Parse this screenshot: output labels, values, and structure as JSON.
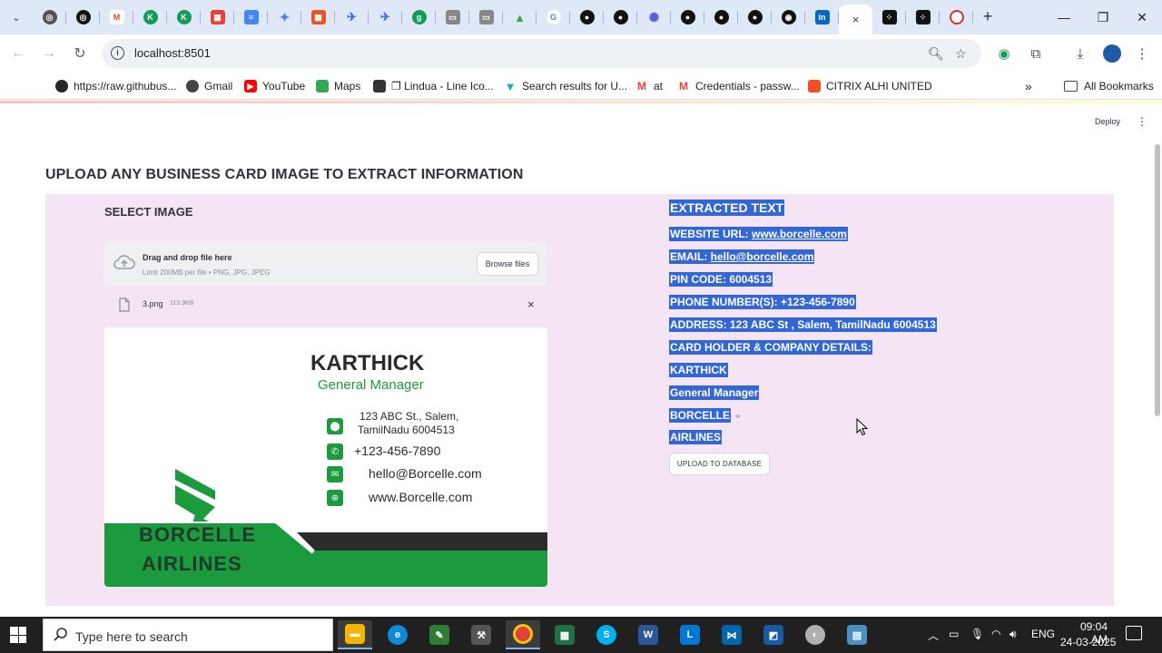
{
  "browser": {
    "tabs_count_note": "",
    "active_tab_close": "×",
    "new_tab": "+",
    "url": "localhost:8501"
  },
  "bookmarks": [
    {
      "label": "https://raw.githubus...",
      "icon": "github-icon",
      "color": "#24292f"
    },
    {
      "label": "Gmail",
      "icon": "globe-icon",
      "color": "#444444"
    },
    {
      "label": "YouTube",
      "icon": "youtube-icon",
      "color": "#ff0000"
    },
    {
      "label": "Maps",
      "icon": "maps-icon",
      "color": "#34a853"
    },
    {
      "label": "❐ Lindua - Line Ico...",
      "icon": "lindua-icon",
      "color": "#333333"
    },
    {
      "label": "Search results for U...",
      "icon": "vector-icon",
      "color": "#20b2aa"
    },
    {
      "label": "at",
      "icon": "gmail-icon",
      "color": "#ea4335"
    },
    {
      "label": "Credentials - passw...",
      "icon": "gmail-icon",
      "color": "#ea4335"
    },
    {
      "label": "CITRIX ALHI UNITED",
      "icon": "windows-icon",
      "color": "#f25022"
    }
  ],
  "bookmarks_more": "»",
  "all_bookmarks": "All Bookmarks",
  "app": {
    "deploy": "Deploy",
    "title": "UPLOAD ANY BUSINESS CARD IMAGE TO EXTRACT INFORMATION",
    "select_label": "SELECT IMAGE",
    "dropzone": {
      "title": "Drag and drop file here",
      "limit": "Limit 200MB per file • PNG, JPG, JPEG",
      "browse": "Browse files"
    },
    "file": {
      "name": "3.png",
      "size": "113.9KB",
      "remove": "×"
    },
    "card": {
      "name": "KARTHICK",
      "role": "General Manager",
      "address_line1": "123 ABC St., Salem,",
      "address_line2": "TamilNadu 6004513",
      "phone": "+123-456-7890",
      "email": "hello@Borcelle.com",
      "website": "www.Borcelle.com",
      "brand_line1": "BORCELLE",
      "brand_line2": "AIRLINES"
    },
    "extracted": {
      "title": "EXTRACTED TEXT",
      "website_label": "WEBSITE URL: ",
      "website_value": "www.borcelle.com",
      "email_label": "EMAIL: ",
      "email_value": "hello@borcelle.com",
      "pin": "PIN CODE: 6004513",
      "phone": "PHONE NUMBER(S): +123-456-7890",
      "address": "ADDRESS: 123 ABC St , Salem, TamilNadu 6004513",
      "details_header": "CARD HOLDER & COMPANY DETAILS:",
      "holder": "KARTHICK",
      "designation": "General Manager",
      "company1": "BORCELLE",
      "company2": "AIRLINES"
    },
    "upload_button": "UPLOAD TO DATABASE"
  },
  "taskbar": {
    "search_placeholder": "Type here to search",
    "lang": "ENG",
    "time": "09:04 AM",
    "date": "24-03-2025"
  },
  "colors": {
    "highlight": "#3367d6",
    "panel": "#f5e4f4",
    "card_green": "#1b9a3e"
  }
}
